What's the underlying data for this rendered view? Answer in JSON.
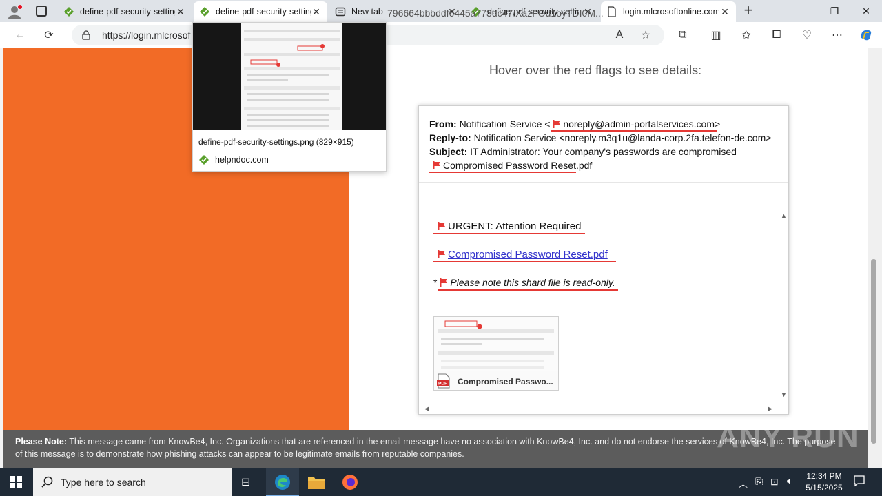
{
  "browser": {
    "tabs": [
      {
        "title": "define-pdf-security-settings",
        "state": "normal"
      },
      {
        "title": "define-pdf-security-settings",
        "state": "hovered"
      },
      {
        "title": "New tab",
        "state": "normal"
      },
      {
        "title": "define-pdf-security-settings",
        "state": "normal"
      },
      {
        "title": "login.mlcrosoftonline.com",
        "state": "active"
      }
    ],
    "url_visible": "https://login.mlcrosof",
    "url_tail": "796664bbbddf6445a773dc47/XazFOd1oyTDI0M..."
  },
  "page": {
    "hover_title": "Hover over the red flags to see details:",
    "email": {
      "from_label": "From:",
      "from_name": "Notification Service <",
      "from_addr": "noreply@admin-portalservices.com",
      "from_close": ">",
      "replyto_label": "Reply-to:",
      "replyto_value": "Notification Service <noreply.m3q1u@landa-corp.2fa.telefon-de.com>",
      "subject_label": "Subject:",
      "subject_value": "IT Administrator: Your company's passwords are compromised",
      "attachment_header": "Compromised Password Reset.pdf",
      "urgent": "URGENT: Attention Required",
      "link_text": "Compromised Password Reset.pdf",
      "note_prefix": "*",
      "note_text": "Please note this shard file is read-only.",
      "attachment_label": "Compromised Passwo..."
    },
    "footer_note_label": "Please Note:",
    "footer_note_text": "This message came from KnowBe4, Inc. Organizations that are referenced in the email message have no association with KnowBe4, Inc. and do not endorse the services of KnowBe4, Inc. The purpose of this message is to demonstrate how phishing attacks can appear to be legitimate emails from reputable companies.",
    "watermark": "ANY RUN"
  },
  "popup": {
    "file": "define-pdf-security-settings.png (829×915)",
    "site": "helpndoc.com"
  },
  "taskbar": {
    "search_placeholder": "Type here to search",
    "time": "12:34 PM",
    "date": "5/15/2025"
  },
  "colors": {
    "orange": "#f26b26",
    "flag_red": "#e53935",
    "link": "#3333cc"
  }
}
